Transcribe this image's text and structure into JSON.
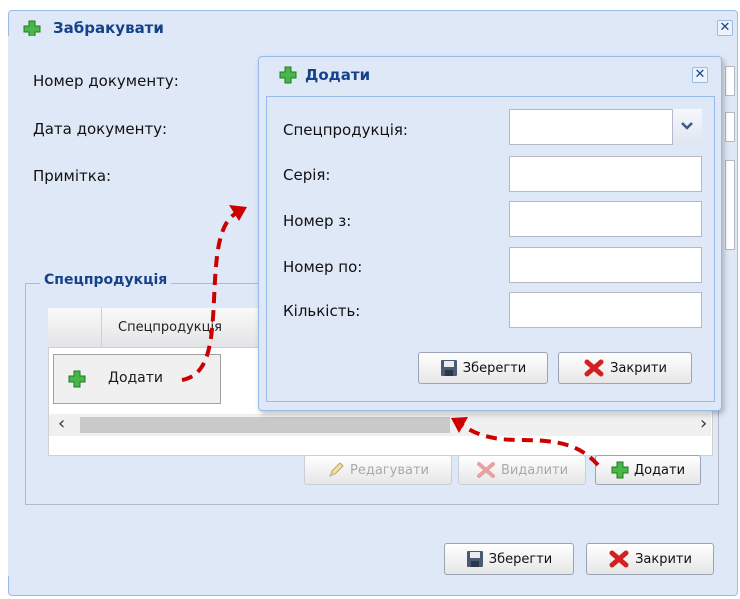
{
  "outer_window": {
    "title": "Забракувати",
    "close_symbol": "✕",
    "fields": {
      "doc_number_label": "Номер документу:",
      "doc_date_label": "Дата документу:",
      "note_label": "Примітка:"
    },
    "fieldset_title": "Спецпродукція",
    "grid": {
      "columns": [
        "",
        "Спецпродукція"
      ],
      "scroll_left": "‹",
      "scroll_right": "›"
    },
    "context_menu": {
      "add_label": "Додати"
    },
    "grid_buttons": {
      "edit": "Редагувати",
      "delete": "Видалити",
      "add": "Додати"
    },
    "footer_buttons": {
      "save": "Зберегти",
      "close": "Закрити"
    }
  },
  "inner_dialog": {
    "title": "Додати",
    "close_symbol": "✕",
    "fields": {
      "product_label": "Спецпродукція:",
      "series_label": "Серія:",
      "number_from_label": "Номер з:",
      "number_to_label": "Номер по:",
      "quantity_label": "Кількість:"
    },
    "buttons": {
      "save": "Зберегти",
      "close": "Закрити"
    }
  },
  "colors": {
    "accent": "#15428b",
    "panel_bg": "#dfe8f6",
    "border": "#99bbe8",
    "arrow": "#cc0000",
    "plus_green": "#2e9e2e",
    "close_red": "#d32020"
  },
  "icons": [
    "plus-icon",
    "close-icon",
    "chevron-down-icon",
    "save-icon",
    "cross-icon",
    "pencil-icon",
    "arrow-annotation"
  ]
}
